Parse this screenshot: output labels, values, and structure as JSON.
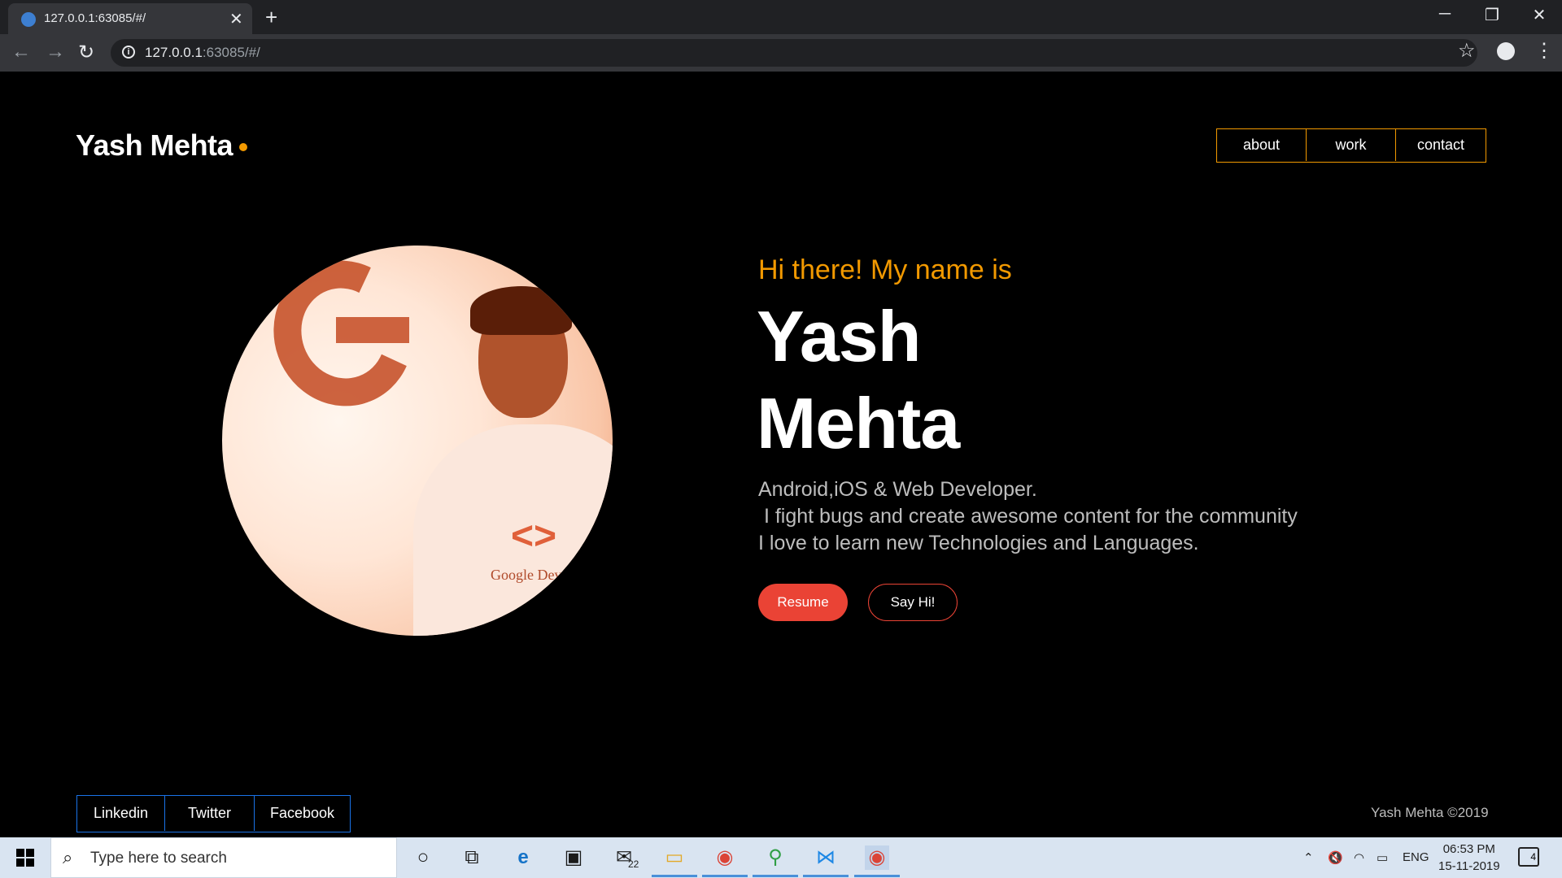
{
  "browser": {
    "tab_title": "127.0.0.1:63085/#/",
    "url_host": "127.0.0.1",
    "url_rest": ":63085/#/"
  },
  "site": {
    "brand": "Yash Mehta",
    "nav": [
      "about",
      "work",
      "contact"
    ],
    "greeting": "Hi there! My name is",
    "name_first": "Yash",
    "name_last": "Mehta",
    "bio": "Android,iOS & Web Developer.\n I fight bugs and create awesome content for the community\nI love to learn new Technologies and Languages.",
    "buttons": {
      "resume": "Resume",
      "say_hi": "Say Hi!"
    },
    "avatar_shirt_text": "Google Devel",
    "social": [
      "Linkedin",
      "Twitter",
      "Facebook"
    ],
    "copyright": "Yash Mehta ©2019"
  },
  "taskbar": {
    "search_placeholder": "Type here to search",
    "mail_badge": "22",
    "language": "ENG",
    "time": "06:53 PM",
    "date": "15-11-2019",
    "notifications": "4"
  },
  "colors": {
    "accent_orange": "#f29900",
    "accent_red": "#ea4335",
    "accent_blue": "#1a73e8"
  }
}
